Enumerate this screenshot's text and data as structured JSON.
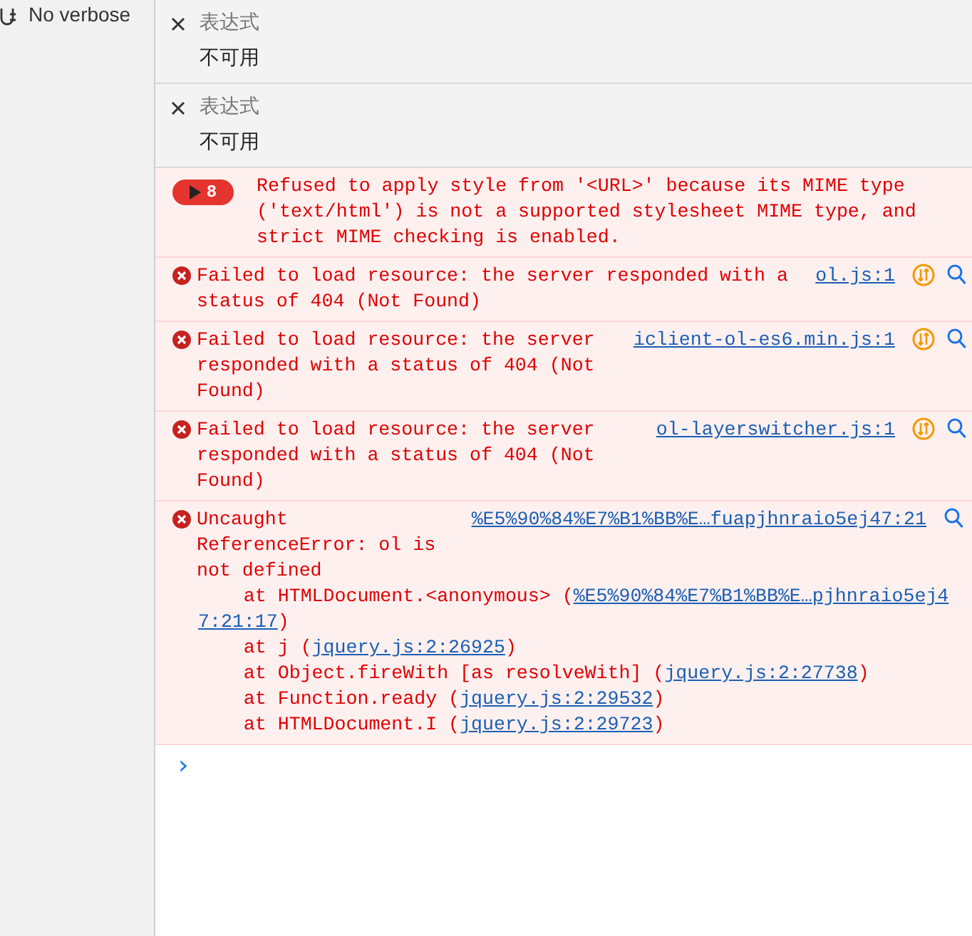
{
  "sidebar": {
    "level_filter": "No verbose"
  },
  "watches": [
    {
      "label": "表达式",
      "value": "不可用"
    },
    {
      "label": "表达式",
      "value": "不可用"
    }
  ],
  "messages": [
    {
      "kind": "group",
      "count": "8",
      "text": "Refused to apply style from '<URL>' because its MIME type ('text/html') is not a supported stylesheet MIME type, and strict MIME checking is enabled."
    },
    {
      "kind": "error",
      "text": "Failed to load resource: the server responded with a status of 404 (Not Found)",
      "source": "ol.js:1",
      "network": true
    },
    {
      "kind": "error",
      "text": "Failed to load resource: the server responded with a status of 404 (Not Found)",
      "source": "iclient-ol-es6.min.js:1",
      "network": true
    },
    {
      "kind": "error",
      "text": "Failed to load resource: the server responded with a status of 404 (Not Found)",
      "source": "ol-layerswitcher.js:1",
      "network": true
    },
    {
      "kind": "error",
      "text": "Uncaught ReferenceError: ol is not defined",
      "source": "%E5%90%84%E7%B1%BB%E…fuapjhnraio5ej47:21",
      "network": false,
      "stack": [
        {
          "before": "    at HTMLDocument.<anonymous> (",
          "link": [
            "%E5%90%84%E7%B1%BB%E…pjhnraio5ej4",
            "7:21:17"
          ],
          "after": ")"
        },
        {
          "before": "    at j (",
          "link": "jquery.js:2:26925",
          "after": ")"
        },
        {
          "before": "    at Object.fireWith [as resolveWith] (",
          "link": "jquery.js:2:27738",
          "after": ")"
        },
        {
          "before": "    at Function.ready (",
          "link": "jquery.js:2:29532",
          "after": ")"
        },
        {
          "before": "    at HTMLDocument.I (",
          "link": "jquery.js:2:29723",
          "after": ")"
        }
      ]
    }
  ],
  "prompt": "›"
}
